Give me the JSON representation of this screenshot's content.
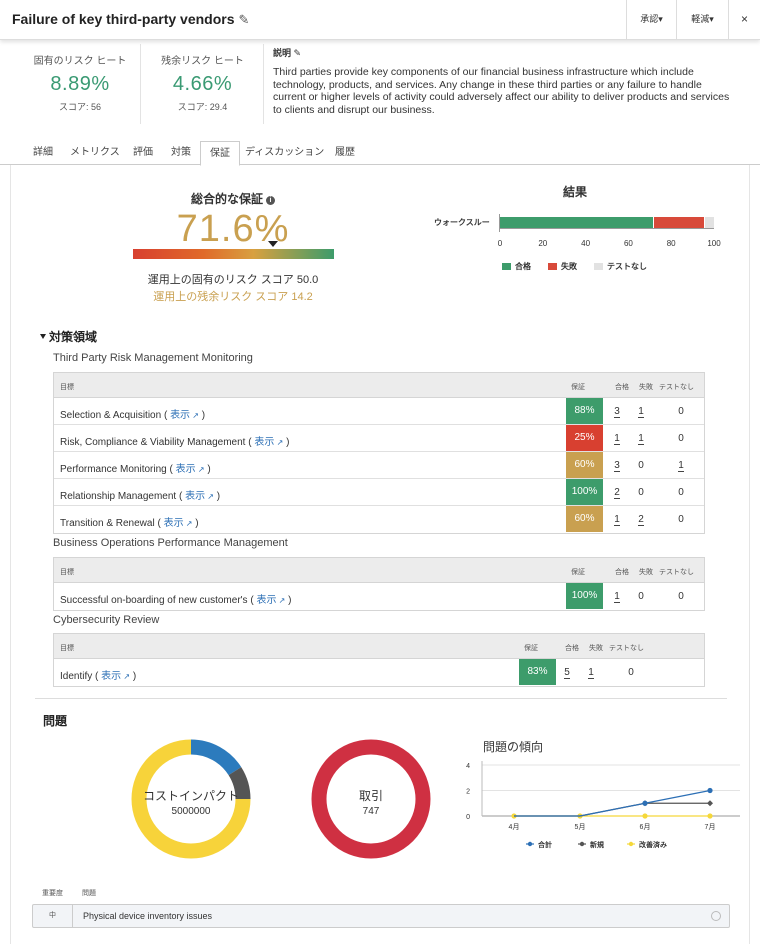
{
  "header": {
    "title": "Failure of key third-party vendors",
    "approve_label": "承認▾",
    "mitigate_label": "軽減▾",
    "close_label": "×"
  },
  "inherent_risk": {
    "label": "固有のリスク ヒート",
    "value": "8.89%",
    "score": "スコア: 56"
  },
  "residual_risk": {
    "label": "残余リスク ヒート",
    "value": "4.66%",
    "score": "スコア: 29.4"
  },
  "description": {
    "label": "説明",
    "text": "Third parties provide key components of our financial business infrastructure which include technology, products, and services. Any change in these third parties or any failure to handle current or higher levels of activity could adversely affect our ability to deliver products and services to clients and disrupt our business."
  },
  "tabs": [
    {
      "label": "詳細"
    },
    {
      "label": "メトリクス"
    },
    {
      "label": "評価"
    },
    {
      "label": "対策"
    },
    {
      "label": "保証"
    },
    {
      "label": "ディスカッション"
    },
    {
      "label": "履歴"
    }
  ],
  "assurance": {
    "title": "総合的な保証",
    "overall": "71.6%",
    "overall_fraction": 0.716,
    "inherent_text": "運用上の固有のリスク スコア 50.0",
    "residual_text": "運用上の残余リスク スコア 14.2"
  },
  "chart_data": [
    {
      "type": "bar",
      "title": "結果",
      "categories": [
        "ウォークスルー"
      ],
      "series": [
        {
          "name": "合格",
          "values": [
            72
          ],
          "color": "#3d9c6b"
        },
        {
          "name": "失敗",
          "values": [
            24
          ],
          "color": "#d84a3a"
        },
        {
          "name": "テストなし",
          "values": [
            4
          ],
          "color": "#e2e2e2"
        }
      ],
      "orientation": "horizontal",
      "stacked": true,
      "xticks": [
        "0",
        "20",
        "40",
        "60",
        "80",
        "100"
      ],
      "xlim": [
        0,
        100
      ]
    },
    {
      "type": "line",
      "title": "問題の傾向",
      "categories": [
        "4月",
        "5月",
        "6月",
        "7月"
      ],
      "yticks": [
        "0",
        "2",
        "4"
      ],
      "ylim": [
        0,
        4
      ],
      "series": [
        {
          "name": "合計",
          "values": [
            0,
            0,
            1,
            2
          ],
          "color": "#2c6fb5"
        },
        {
          "name": "新規",
          "values": [
            0,
            0,
            1,
            1
          ],
          "color": "#555555"
        },
        {
          "name": "改善済み",
          "values": [
            0,
            0,
            0,
            0
          ],
          "color": "#f5d83a"
        }
      ]
    },
    {
      "type": "pie",
      "title": "コストインパクト",
      "value_label": "5000000",
      "slices": [
        {
          "value": 0.16,
          "color": "#2c7bbd"
        },
        {
          "value": 0.09,
          "color": "#555555"
        },
        {
          "value": 0.75,
          "color": "#f7d33a"
        }
      ]
    },
    {
      "type": "pie",
      "title": "取引",
      "value_label": "747",
      "slices": [
        {
          "value": 1.0,
          "color": "#cf3042"
        }
      ]
    }
  ],
  "controls_section": {
    "title": "対策領域"
  },
  "table_headers": {
    "target": "目標",
    "assurance": "保証",
    "pass": "合格",
    "fail": "失敗",
    "none": "テストなし"
  },
  "view_link": "表示",
  "groups": [
    {
      "name": "Third Party Risk Management Monitoring",
      "rows": [
        {
          "name": "Selection & Acquisition",
          "pct": "88%",
          "color": "#3d9c6b",
          "pass": "3",
          "fail": "1",
          "none": "0"
        },
        {
          "name": "Risk, Compliance & Viability Management",
          "pct": "25%",
          "color": "#d84030",
          "pass": "1",
          "fail": "1",
          "none": "0"
        },
        {
          "name": "Performance Monitoring",
          "pct": "60%",
          "color": "#c9a050",
          "pass": "3",
          "fail": "0",
          "none": "1"
        },
        {
          "name": "Relationship Management",
          "pct": "100%",
          "color": "#3d9c6b",
          "pass": "2",
          "fail": "0",
          "none": "0"
        },
        {
          "name": "Transition & Renewal",
          "pct": "60%",
          "color": "#c9a050",
          "pass": "1",
          "fail": "2",
          "none": "0"
        }
      ]
    },
    {
      "name": "Business Operations Performance Management",
      "rows": [
        {
          "name": "Successful on-boarding of new customer's",
          "pct": "100%",
          "color": "#3d9c6b",
          "pass": "1",
          "fail": "0",
          "none": "0"
        }
      ]
    },
    {
      "name": "Cybersecurity Review",
      "rows": [
        {
          "name": "Identify",
          "pct": "83%",
          "color": "#3d9c6b",
          "pass": "5",
          "fail": "1",
          "none": "0"
        }
      ]
    }
  ],
  "issues": {
    "title": "問題",
    "col_severity": "重要度",
    "col_issue": "問題",
    "rows": [
      {
        "severity": "中",
        "name": "Physical device inventory issues"
      }
    ]
  }
}
